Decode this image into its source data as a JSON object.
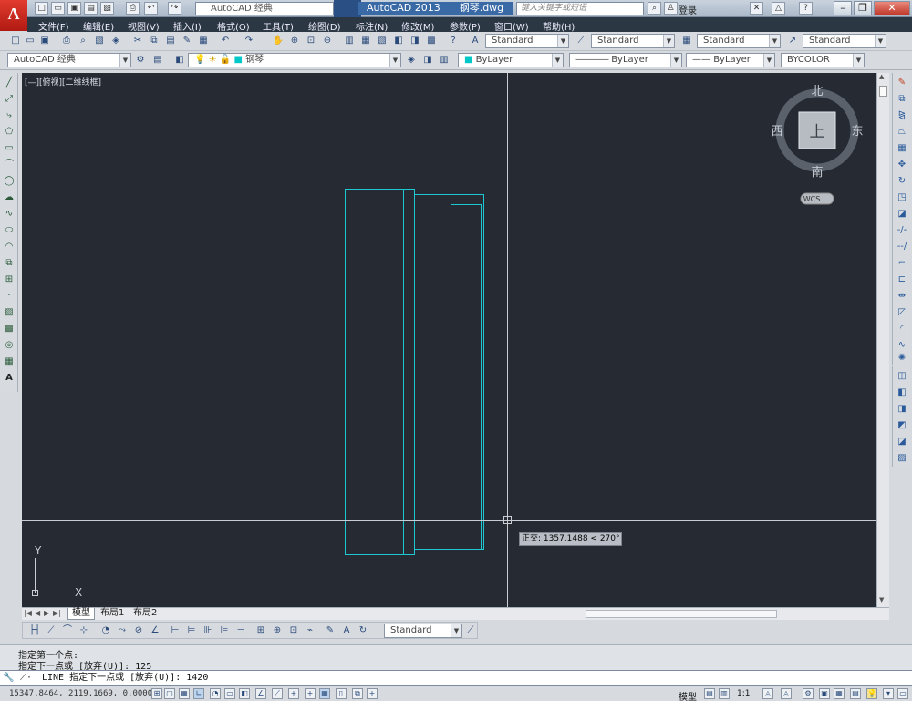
{
  "title_bar": {
    "app_logo": "A",
    "workspace": "AutoCAD 经典",
    "app_name": "AutoCAD 2013",
    "file_name": "钢琴.dwg",
    "search_placeholder": "键入关键字或短语",
    "login_label": "登录"
  },
  "menu": [
    "文件(F)",
    "编辑(E)",
    "视图(V)",
    "插入(I)",
    "格式(O)",
    "工具(T)",
    "绘图(D)",
    "标注(N)",
    "修改(M)",
    "参数(P)",
    "窗口(W)",
    "帮助(H)"
  ],
  "styles_toolbar": {
    "text_style": "Standard",
    "dim_style": "Standard",
    "table_style": "Standard",
    "multileader_style": "Standard"
  },
  "layers_toolbar": {
    "workspace": "AutoCAD 经典",
    "layer": "钢琴",
    "color": "ByLayer",
    "linetype": "ByLayer",
    "lineweight": "ByLayer",
    "plotstyle": "BYCOLOR"
  },
  "viewport": {
    "label": "[—][俯视][二维线框]",
    "tooltip": "正交: 1357.1488 < 270°",
    "ucs_x": "X",
    "ucs_y": "Y"
  },
  "viewcube": {
    "north": "北",
    "south": "南",
    "east": "东",
    "west": "西",
    "face": "上",
    "wcs": "WCS"
  },
  "tabs": [
    "模型",
    "布局1",
    "布局2"
  ],
  "dim_toolbar": {
    "dim_style": "Standard"
  },
  "command": {
    "history": [
      "指定第一个点:",
      "指定下一点或 [放弃(U)]: 125"
    ],
    "prompt": "LINE 指定下一点或 [放弃(U)]: 1420"
  },
  "status_bar": {
    "coordinates": "15347.8464, 2119.1669, 0.0000",
    "model_label": "模型",
    "scale": "1:1"
  }
}
